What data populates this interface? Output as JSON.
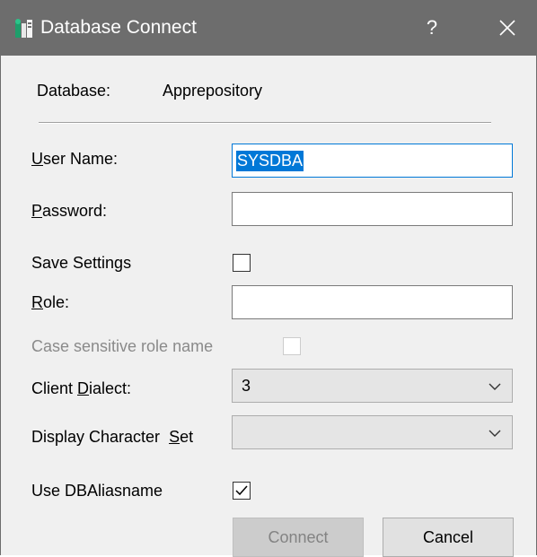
{
  "window": {
    "title": "Database Connect",
    "help_glyph": "?",
    "close_glyph": "✕",
    "app_icon": "database-app-icon"
  },
  "database": {
    "label": "Database:",
    "value": "Apprepository"
  },
  "user_name": {
    "mnemonic": "U",
    "label_rest": "ser Name:",
    "value": "SYSDBA"
  },
  "password": {
    "mnemonic": "P",
    "label_rest": "assword:",
    "value": ""
  },
  "save_settings": {
    "label": "Save Settings",
    "checked": false
  },
  "role": {
    "mnemonic": "R",
    "label_rest": "ole:",
    "value": ""
  },
  "case_sensitive": {
    "label": "Case sensitive role name",
    "checked": false,
    "disabled": true
  },
  "client_dialect": {
    "label_pre": "Client ",
    "mnemonic": "D",
    "label_rest": "ialect:",
    "value": "3"
  },
  "charset": {
    "label_pre": "Display Character  ",
    "mnemonic": "S",
    "label_rest": "et",
    "value": ""
  },
  "use_dbalias": {
    "label": "Use DBAliasname",
    "checked": true
  },
  "buttons": {
    "connect_label": "Connect",
    "cancel_label": "Cancel"
  },
  "colors": {
    "titlebar": "#6d6d6d",
    "accent": "#0078d7",
    "dialog_bg": "#f0f0f0"
  }
}
